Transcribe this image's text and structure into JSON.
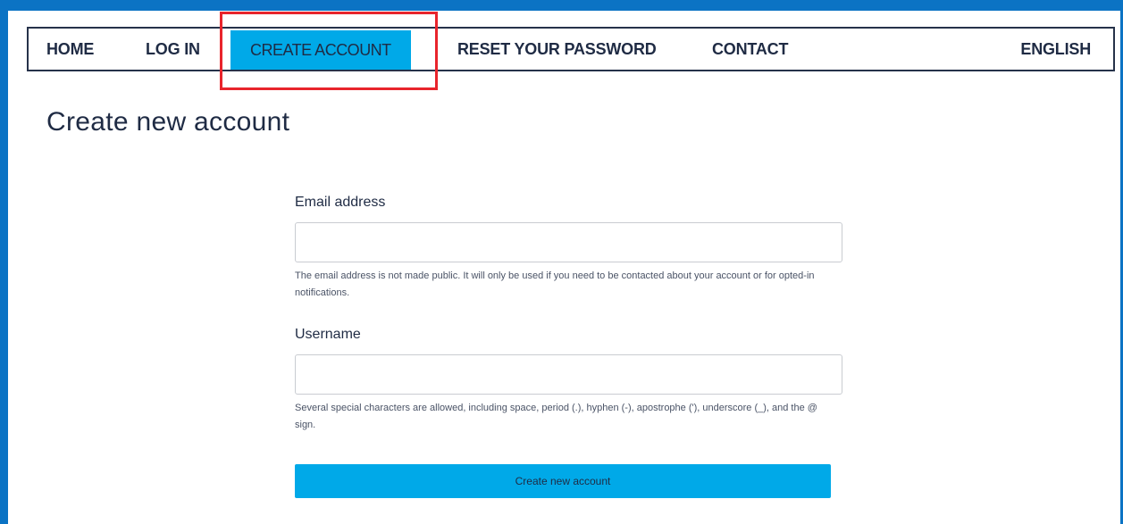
{
  "nav": {
    "items": [
      {
        "label": "HOME"
      },
      {
        "label": "LOG IN"
      },
      {
        "label": "CREATE ACCOUNT"
      },
      {
        "label": "RESET YOUR PASSWORD"
      },
      {
        "label": "CONTACT"
      }
    ],
    "language": "ENGLISH"
  },
  "page": {
    "title": "Create new account"
  },
  "form": {
    "email": {
      "label": "Email address",
      "value": "",
      "help": "The email address is not made public. It will only be used if you need to be contacted about your account or for opted-in notifications."
    },
    "username": {
      "label": "Username",
      "value": "",
      "help": "Several special characters are allowed, including space, period (.), hyphen (-), apostrophe ('), underscore (_), and the @ sign."
    },
    "submit_label": "Create new account"
  },
  "colors": {
    "frame": "#0b73c4",
    "accent": "#00a9e8",
    "highlight": "#e8242c",
    "text": "#1f2b44"
  }
}
